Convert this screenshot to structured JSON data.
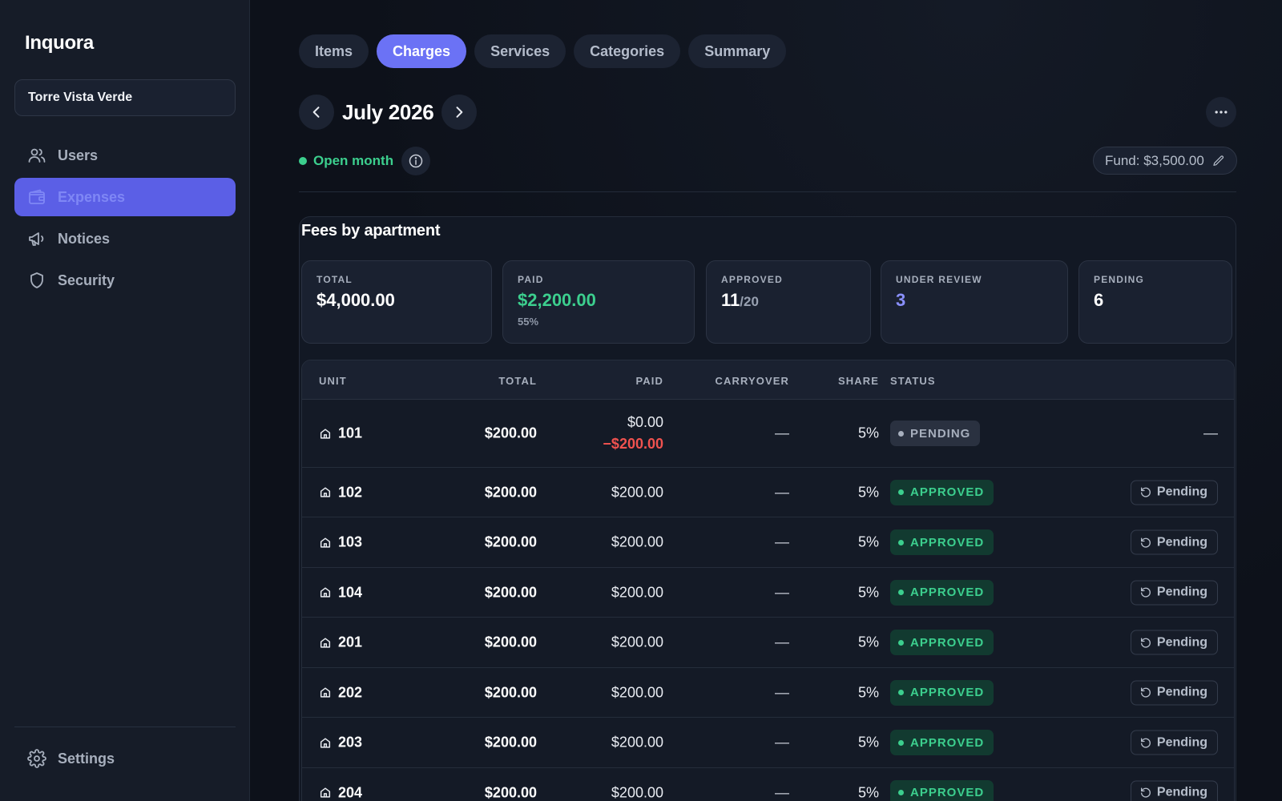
{
  "sidebar": {
    "brand": "Inquora",
    "building": "Torre Vista Verde",
    "items": [
      {
        "label": "Users",
        "icon": "users-icon"
      },
      {
        "label": "Expenses",
        "icon": "wallet-icon",
        "active": true
      },
      {
        "label": "Notices",
        "icon": "megaphone-icon"
      },
      {
        "label": "Security",
        "icon": "shield-icon"
      }
    ],
    "settings": "Settings"
  },
  "tabs": [
    "Items",
    "Charges",
    "Services",
    "Categories",
    "Summary"
  ],
  "active_tab": "Charges",
  "month": "July 2026",
  "month_status": "Open month",
  "fund": "Fund: $3,500.00",
  "panel": {
    "title": "Fees by apartment",
    "stats": {
      "total": {
        "label": "TOTAL",
        "value": "$4,000.00"
      },
      "paid": {
        "label": "PAID",
        "value": "$2,200.00",
        "sub": "55%"
      },
      "approved": {
        "label": "APPROVED",
        "value": "11",
        "of": "/20"
      },
      "under_review": {
        "label": "UNDER REVIEW",
        "value": "3"
      },
      "pending": {
        "label": "PENDING",
        "value": "6"
      }
    },
    "table": {
      "headers": [
        "UNIT",
        "TOTAL",
        "PAID",
        "CARRYOVER",
        "SHARE",
        "STATUS"
      ],
      "rows": [
        {
          "unit": "101",
          "total": "$200.00",
          "paid": "$0.00",
          "balance": "−$200.00",
          "carryover": "—",
          "share": "5%",
          "status": "PENDING",
          "action": "—"
        },
        {
          "unit": "102",
          "total": "$200.00",
          "paid": "$200.00",
          "carryover": "—",
          "share": "5%",
          "status": "APPROVED",
          "action": "Pending"
        },
        {
          "unit": "103",
          "total": "$200.00",
          "paid": "$200.00",
          "carryover": "—",
          "share": "5%",
          "status": "APPROVED",
          "action": "Pending"
        },
        {
          "unit": "104",
          "total": "$200.00",
          "paid": "$200.00",
          "carryover": "—",
          "share": "5%",
          "status": "APPROVED",
          "action": "Pending"
        },
        {
          "unit": "201",
          "total": "$200.00",
          "paid": "$200.00",
          "carryover": "—",
          "share": "5%",
          "status": "APPROVED",
          "action": "Pending"
        },
        {
          "unit": "202",
          "total": "$200.00",
          "paid": "$200.00",
          "carryover": "—",
          "share": "5%",
          "status": "APPROVED",
          "action": "Pending"
        },
        {
          "unit": "203",
          "total": "$200.00",
          "paid": "$200.00",
          "carryover": "—",
          "share": "5%",
          "status": "APPROVED",
          "action": "Pending"
        },
        {
          "unit": "204",
          "total": "$200.00",
          "paid": "$200.00",
          "carryover": "—",
          "share": "5%",
          "status": "APPROVED",
          "action": "Pending"
        }
      ]
    }
  },
  "colors": {
    "accent": "#6b72f5",
    "sidebar_active": "#5b5fe6",
    "approved": "#3ccf8e",
    "negative": "#f0524f",
    "background": "#0d111a"
  }
}
